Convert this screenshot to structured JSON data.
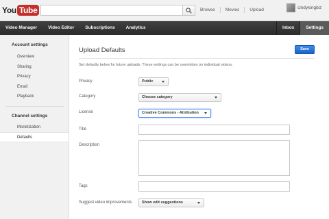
{
  "header": {
    "logo_you": "You",
    "logo_tube": "Tube",
    "search_placeholder": "",
    "links": [
      "Browse",
      "Movies",
      "Upload"
    ],
    "username": "cindykingbiz"
  },
  "nav": {
    "left": [
      "Video Manager",
      "Video Editor",
      "Subscriptions",
      "Analytics"
    ],
    "right": [
      "Inbox",
      "Settings"
    ],
    "active": "Settings"
  },
  "sidebar": {
    "account_heading": "Account settings",
    "account_items": [
      "Overview",
      "Sharing",
      "Privacy",
      "Email",
      "Playback"
    ],
    "channel_heading": "Channel settings",
    "channel_items": [
      "Monetization",
      "Defaults"
    ],
    "active_item": "Defaults"
  },
  "main": {
    "title": "Upload Defaults",
    "save_label": "Save",
    "description": "Set defaults below for future uploads. These settings can be overridden on individual videos.",
    "fields": {
      "privacy_label": "Privacy",
      "privacy_value": "Public",
      "category_label": "Category",
      "category_value": "Choose category",
      "license_label": "License",
      "license_value": "Creative Commons - Attribution",
      "title_label": "Title",
      "title_value": "",
      "description_label": "Description",
      "description_value": "",
      "tags_label": "Tags",
      "tags_value": "",
      "suggest_label": "Suggest video improvements",
      "suggest_value": "Show edit suggestions"
    }
  },
  "colors": {
    "brand_red": "#c4302b",
    "nav_bg": "#333333",
    "save_blue": "#1c62c8",
    "focus_blue": "#4d90fe"
  }
}
